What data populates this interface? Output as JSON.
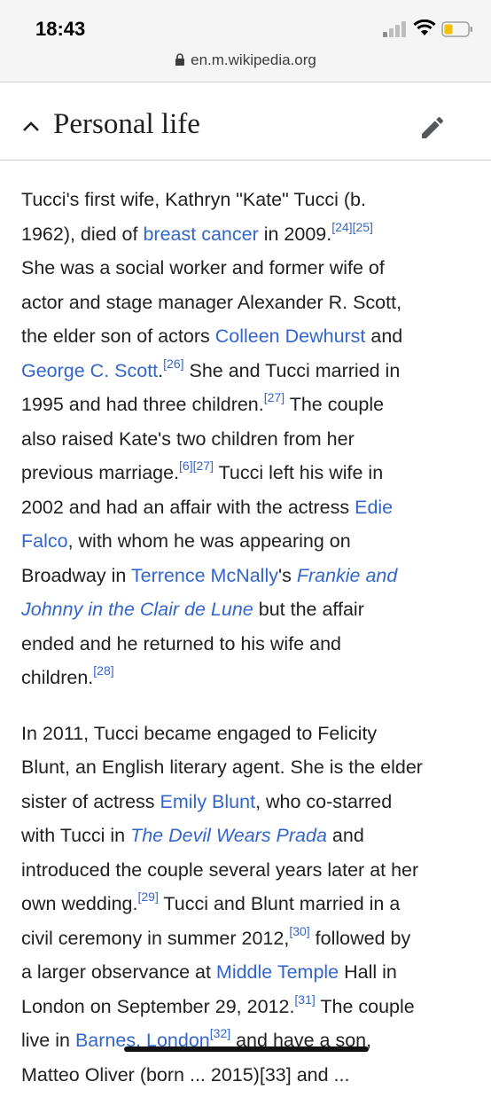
{
  "status_bar": {
    "time": "18:43",
    "url": "en.m.wikipedia.org"
  },
  "section": {
    "title": "Personal life"
  },
  "colors": {
    "link": "#3366cc",
    "text": "#202122"
  },
  "icons": [
    "lock-icon",
    "chevron-up-icon",
    "edit-icon",
    "signal-icon",
    "wifi-icon",
    "battery-icon"
  ],
  "p1": {
    "l1": "Tucci's first wife, Kathryn \"Kate\" Tucci (b.",
    "l2a": "1962), died of ",
    "l2_link": "breast cancer",
    "l2b": " in 2009.",
    "ref24": "[24]",
    "ref25": "[25]",
    "l3": "She was a social worker and former wife of",
    "l4": "actor and stage manager Alexander R. Scott,",
    "l5a": "the elder son of actors ",
    "l5_link": "Colleen Dewhurst",
    "l5b": " and",
    "l6_link": "George C. Scott",
    "l6a": ".",
    "ref26": "[26]",
    "l6b": " She and Tucci married in",
    "l7a": "1995 and had three children.",
    "ref27a": "[27]",
    "l7b": " The couple",
    "l8": "also raised Kate's two children from her",
    "l9a": "previous marriage.",
    "ref6": "[6]",
    "ref27b": "[27]",
    "l9b": " Tucci left his wife in",
    "l10a": "2002 and had an affair with the actress ",
    "l10_link": "Edie",
    "l11_link": "Falco",
    "l11a": ", with whom he was appearing on",
    "l12a": "Broadway in ",
    "l12_link": "Terrence McNally",
    "l12b": "'s ",
    "l12_italic": "Frankie and",
    "l13_italic": "Johnny in the Clair de Lune",
    "l13a": " but the affair",
    "l14": "ended and he returned to his wife and",
    "l15a": "children.",
    "ref28": "[28]"
  },
  "p2": {
    "l1": "In 2011, Tucci became engaged to Felicity",
    "l2": "Blunt, an English literary agent. She is the elder",
    "l3a": "sister of actress ",
    "l3_link": "Emily Blunt",
    "l3b": ", who co-starred",
    "l4a": "with Tucci in ",
    "l4_italic": "The Devil Wears Prada",
    "l4b": " and",
    "l5": "introduced the couple several years later at her",
    "l6a": "own wedding.",
    "ref29": "[29]",
    "l6b": " Tucci and Blunt married in a",
    "l7a": "civil ceremony in summer 2012,",
    "ref30": "[30]",
    "l7b": " followed by",
    "l8a": "a larger observance at ",
    "l8_link": "Middle Temple",
    "l8b": " Hall in",
    "l9a": "London on September 29, 2012.",
    "ref31": "[31]",
    "l9b": " The couple",
    "l10a": "live in ",
    "l10_link": "Barnes, London",
    "ref32": "[32]",
    "l10b": " and have a son,",
    "l11": "Matteo Oliver (born ... 2015)[33] and ..."
  }
}
